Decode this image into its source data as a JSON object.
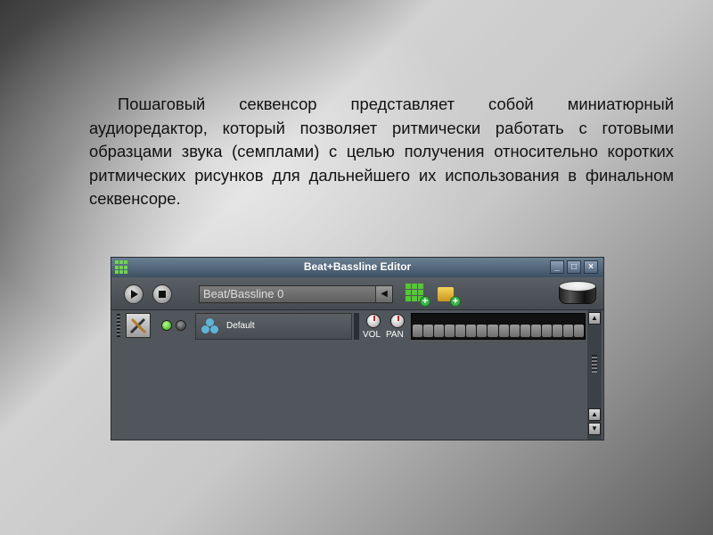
{
  "slide": {
    "paragraph": "Пошаговый секвенсор представляет собой миниатюрный аудиоредактор, который позволяет ритмически работать с готовыми образцами звука (семплами) с целью получения относительно коротких ритмических рисунков для дальнейшего их использования в финальном секвенсоре."
  },
  "window": {
    "title": "Beat+Bassline Editor",
    "minimize_label": "_",
    "maximize_label": "□",
    "close_label": "×"
  },
  "toolbar": {
    "play_icon": "play-icon",
    "stop_icon": "stop-icon",
    "bb_selector_value": "Beat/Bassline 0",
    "bb_selector_arrow": "◀",
    "add_beat_icon": "add-beat-bassline-icon",
    "add_automation_icon": "add-automation-track-icon",
    "drum_icon": "drum-icon"
  },
  "track": {
    "name": "Default",
    "vol_label": "VOL",
    "pan_label": "PAN",
    "step_count": 16
  },
  "scrollbar": {
    "up": "▲",
    "down": "▼"
  },
  "colors": {
    "accent_green": "#52c92f",
    "titlebar": "#4f6478",
    "knob_tick": "#d21f1f"
  }
}
